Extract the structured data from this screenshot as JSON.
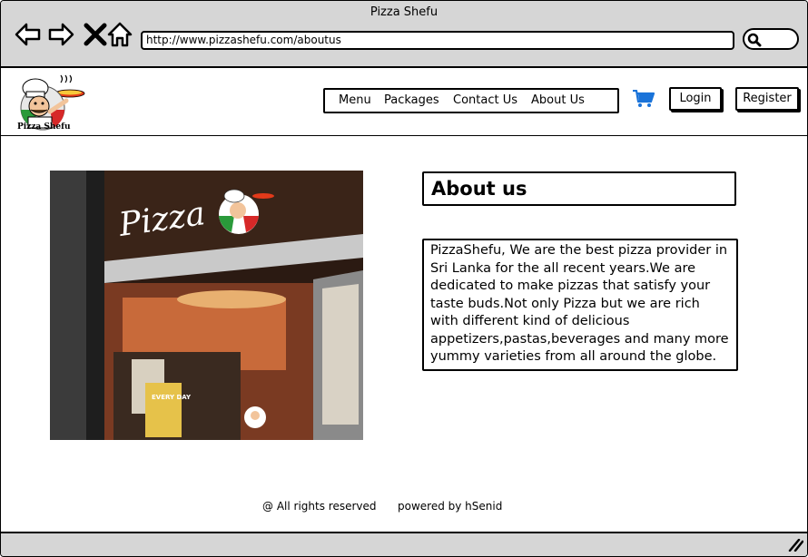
{
  "window": {
    "title": "Pizza Shefu",
    "url": "http://www.pizzashefu.com/aboutus"
  },
  "brand": {
    "logo_text": "Pizza Shefu"
  },
  "nav": {
    "items": [
      "Menu",
      "Packages",
      "Contact Us",
      "About Us"
    ]
  },
  "auth": {
    "login_label": "Login",
    "register_label": "Register"
  },
  "content": {
    "title": "About us",
    "body": "PizzaShefu, We are the best pizza provider in Sri Lanka for the all recent years.We are dedicated to make pizzas that satisfy your taste buds.Not only Pizza but we are rich with different kind of delicious appetizers,pastas,beverages and many more yummy varieties from all around the globe.",
    "photo": {
      "sign_text": "Pizza",
      "promo_text": "EVERY DAY"
    }
  },
  "footer": {
    "rights": "@ All rights reserved",
    "powered": "powered by hSenid"
  },
  "icons": {
    "back": "arrow-left-icon",
    "forward": "arrow-right-icon",
    "close": "close-x-icon",
    "home": "home-icon",
    "search": "search-icon",
    "cart": "shopping-cart-icon",
    "resize": "resize-grip-icon"
  },
  "colors": {
    "cart": "#1a73d9",
    "chrome": "#d6d6d6"
  }
}
